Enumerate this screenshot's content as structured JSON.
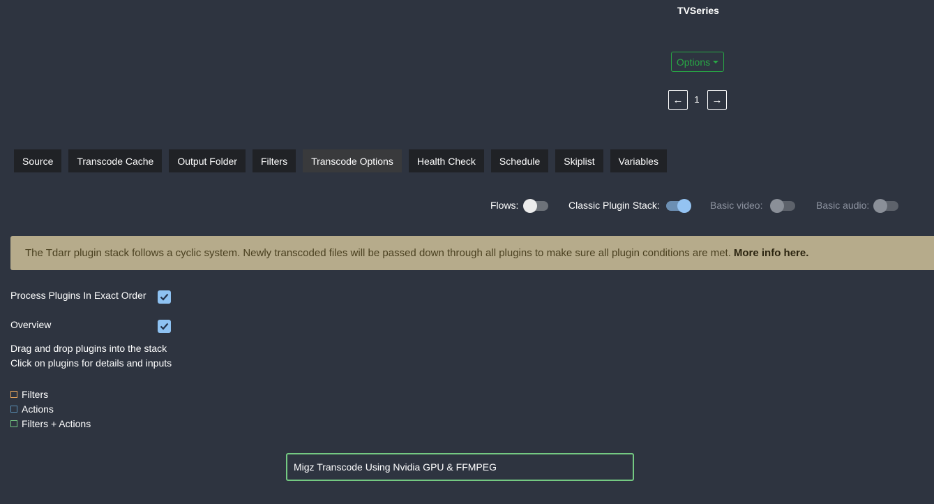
{
  "library": {
    "name": "TVSeries"
  },
  "options_button": {
    "label": "Options"
  },
  "pagination": {
    "prev": "←",
    "current": "1",
    "next": "→"
  },
  "tabs": [
    {
      "label": "Source"
    },
    {
      "label": "Transcode Cache"
    },
    {
      "label": "Output Folder"
    },
    {
      "label": "Filters"
    },
    {
      "label": "Transcode Options",
      "active": true
    },
    {
      "label": "Health Check"
    },
    {
      "label": "Schedule"
    },
    {
      "label": "Skiplist"
    },
    {
      "label": "Variables"
    }
  ],
  "toggles": {
    "flows": {
      "label": "Flows:",
      "on": false
    },
    "classic": {
      "label": "Classic Plugin Stack:",
      "on": true
    },
    "basic_video": {
      "label": "Basic video:",
      "on": false
    },
    "basic_audio": {
      "label": "Basic audio:",
      "on": false
    }
  },
  "banner": {
    "text": "The Tdarr plugin stack follows a cyclic system. Newly transcoded files will be passed down through all plugins to make sure all plugin conditions are met.",
    "link": "More info here."
  },
  "settings": {
    "exact_order": {
      "label": "Process Plugins In Exact Order",
      "checked": true
    },
    "overview": {
      "label": "Overview",
      "checked": true
    }
  },
  "instructions": {
    "line1": "Drag and drop plugins into the stack",
    "line2": "Click on plugins for details and inputs"
  },
  "legend": [
    {
      "label": "Filters",
      "color": "#e8a55c"
    },
    {
      "label": "Actions",
      "color": "#5a8fb5"
    },
    {
      "label": "Filters + Actions",
      "color": "#74c982"
    }
  ],
  "plugins": [
    {
      "name": "Migz Transcode Using Nvidia GPU & FFMPEG",
      "color": "#74c982"
    }
  ],
  "colors": {
    "background": "#2e3440",
    "accent_green": "#28a745",
    "banner_bg": "#b6ab8b",
    "checkbox": "#8ec2f2"
  }
}
